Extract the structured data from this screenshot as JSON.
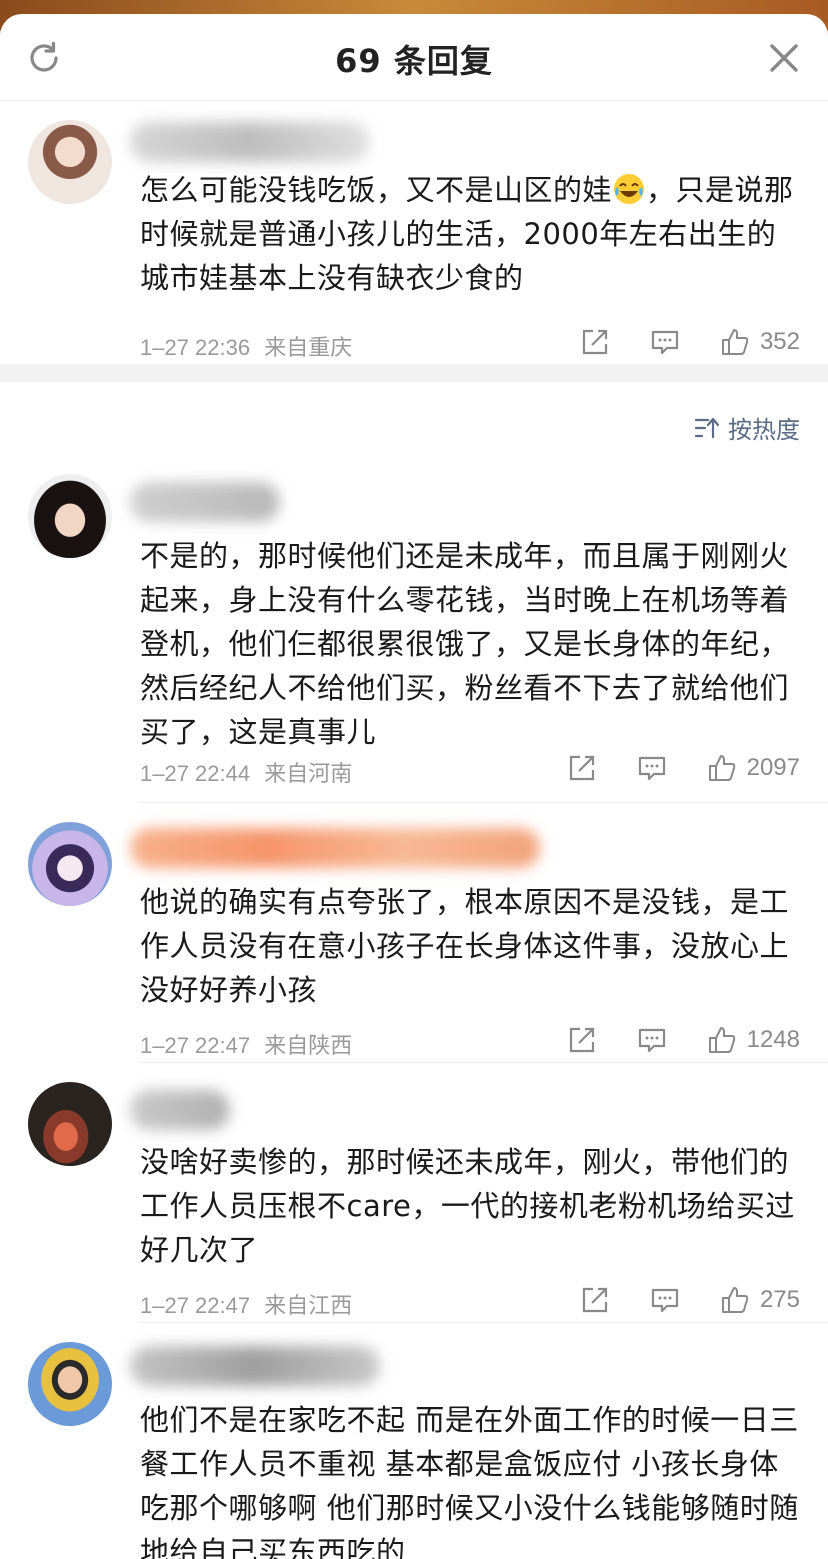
{
  "header": {
    "title": "69 条回复",
    "refresh_icon": "refresh-icon",
    "close_icon": "close-icon"
  },
  "sort": {
    "label": "按热度",
    "icon": "sort-icon"
  },
  "comments": [
    {
      "text_before_emoji": "怎么可能没钱吃饭，又不是山区的娃",
      "emoji": "laughing-crying-emoji",
      "text_after_emoji": "，只是说那时候就是普通小孩儿的生活，2000年左右出生的城市娃基本上没有缺衣少食的",
      "time": "1–27 22:36",
      "location": "来自重庆",
      "likes": "352"
    },
    {
      "text": "不是的，那时候他们还是未成年，而且属于刚刚火起来，身上没有什么零花钱，当时晚上在机场等着登机，他们仨都很累很饿了，又是长身体的年纪，然后经纪人不给他们买，粉丝看不下去了就给他们买了，这是真事儿",
      "time": "1–27 22:44",
      "location": "来自河南",
      "likes": "2097"
    },
    {
      "text": "他说的确实有点夸张了，根本原因不是没钱，是工作人员没有在意小孩子在长身体这件事，没放心上没好好养小孩",
      "time": "1–27 22:47",
      "location": "来自陕西",
      "likes": "1248"
    },
    {
      "text": "没啥好卖惨的，那时候还未成年，刚火，带他们的工作人员压根不care，一代的接机老粉机场给买过好几次了",
      "time": "1–27 22:47",
      "location": "来自江西",
      "likes": "275"
    },
    {
      "text": "他们不是在家吃不起 而是在外面工作的时候一日三餐工作人员不重视 基本都是盒饭应付 小孩长身体吃那个哪够啊 他们那时候又小没什么钱能够随时随地给自己买东西吃的"
    }
  ],
  "colors": {
    "accent": "#5a6c86",
    "meta": "#9a9a9a",
    "divider": "#f1f1f1"
  }
}
